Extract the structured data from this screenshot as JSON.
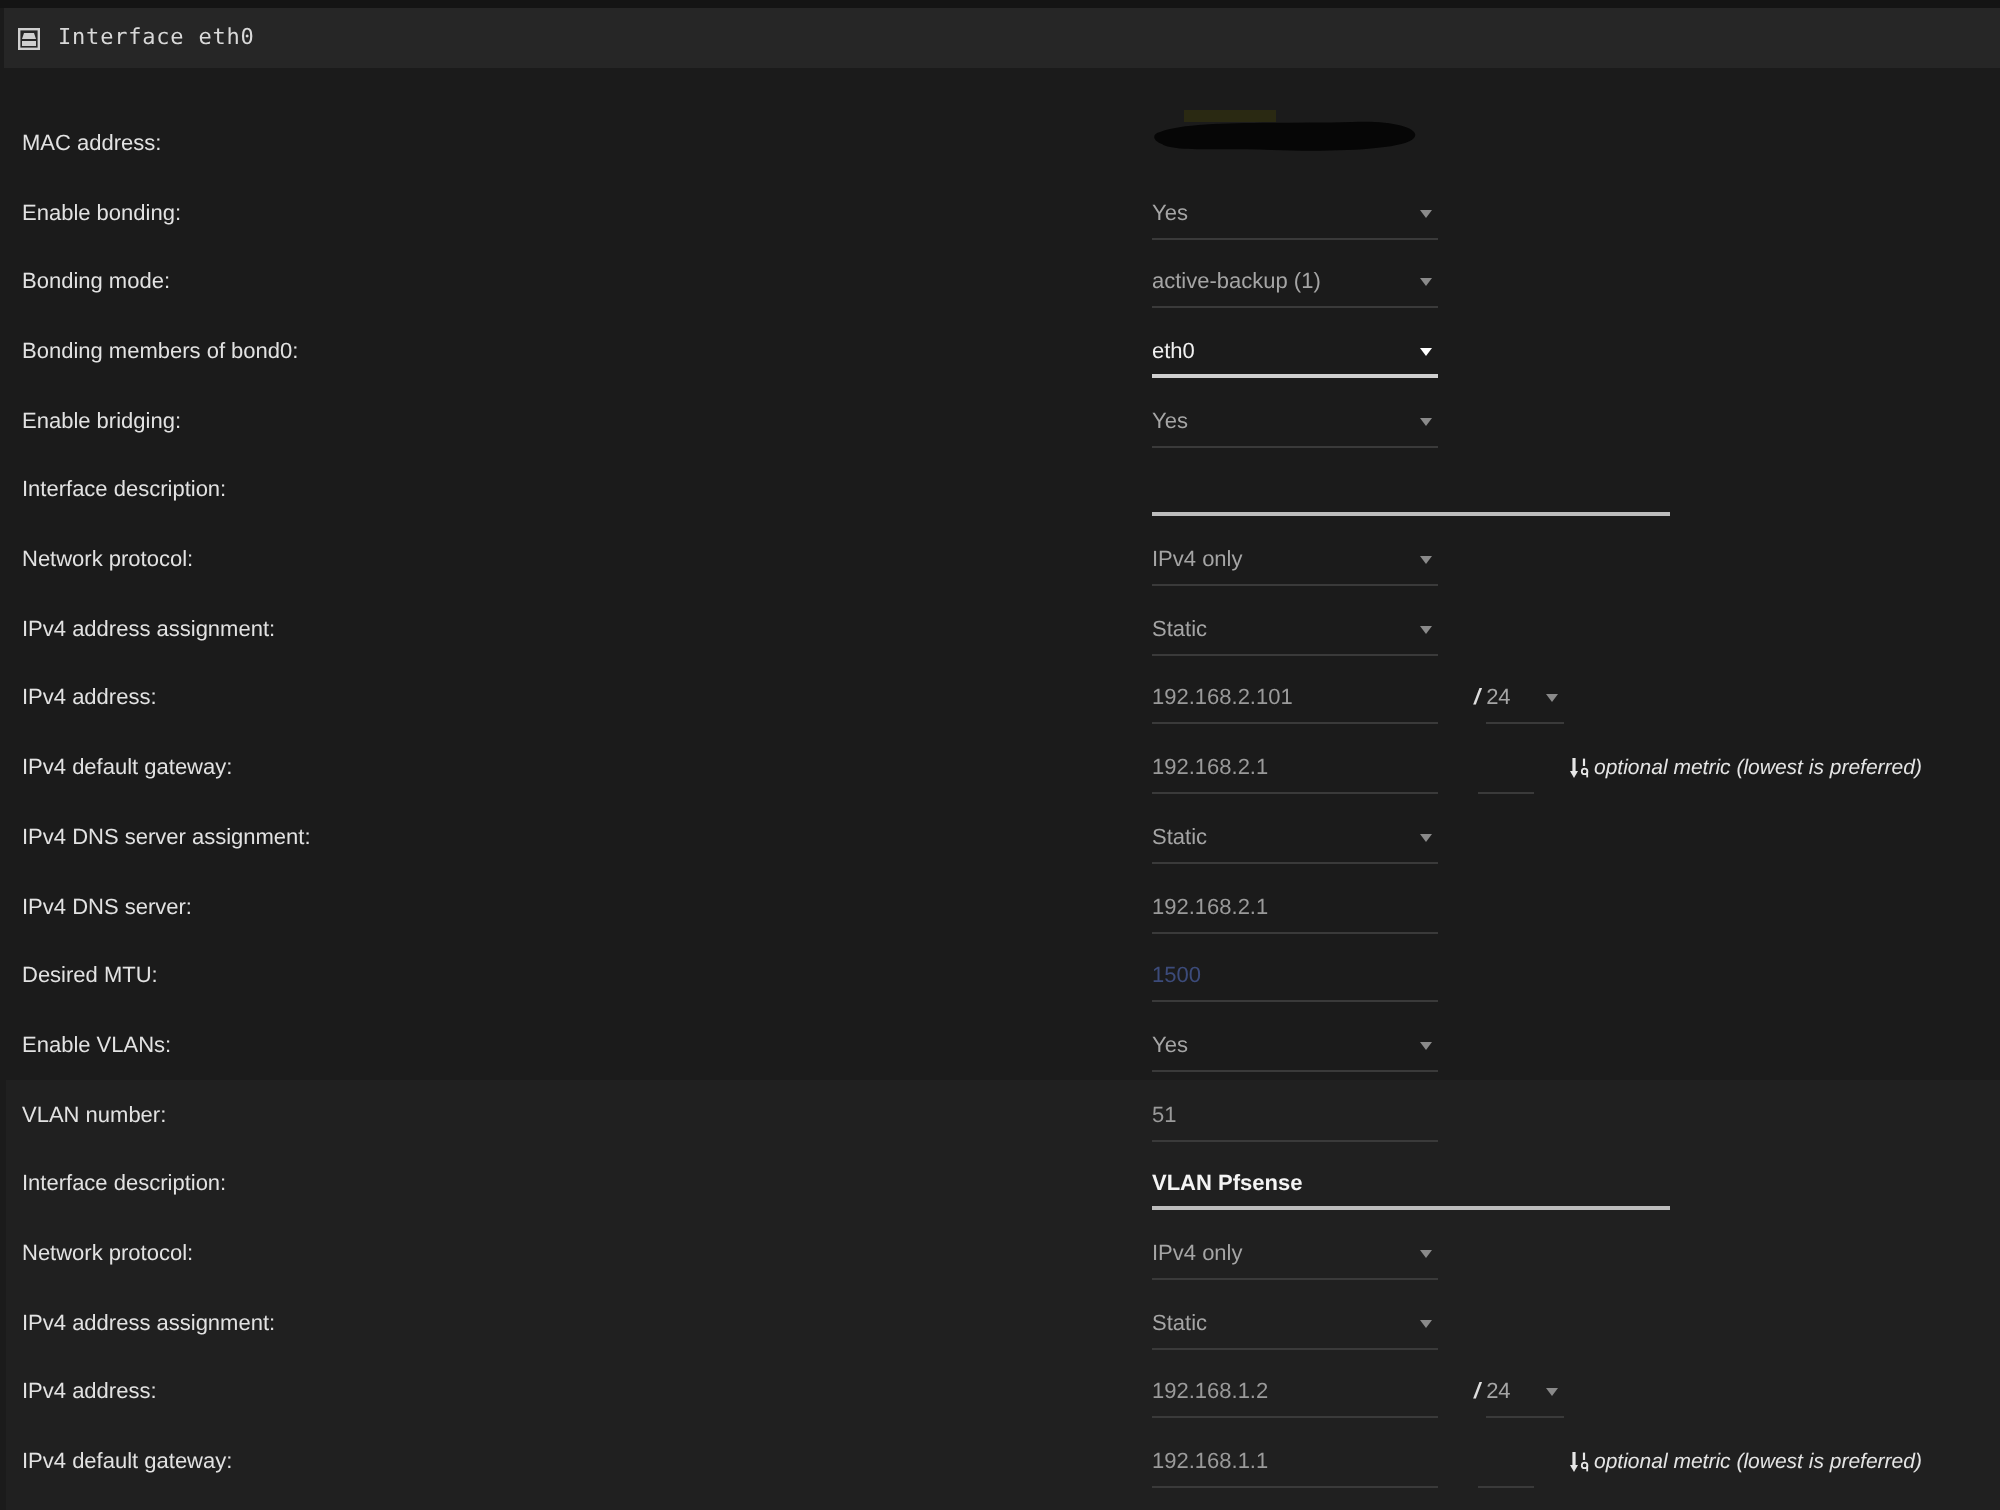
{
  "panel": {
    "title": "Interface eth0"
  },
  "fields": [
    {
      "kind": "redacted",
      "label": "MAC address:"
    },
    {
      "kind": "select",
      "label": "Enable bonding:",
      "value": "Yes",
      "focused": false
    },
    {
      "kind": "select",
      "label": "Bonding mode:",
      "value": "active-backup (1)",
      "focused": false
    },
    {
      "kind": "select",
      "label": "Bonding members of bond0:",
      "value": "eth0",
      "focused": true
    },
    {
      "kind": "select",
      "label": "Enable bridging:",
      "value": "Yes",
      "focused": false
    },
    {
      "kind": "longtext",
      "label": "Interface description:"
    },
    {
      "kind": "select",
      "label": "Network protocol:",
      "value": "IPv4 only",
      "focused": false
    },
    {
      "kind": "select",
      "label": "IPv4 address assignment:",
      "value": "Static",
      "focused": false
    },
    {
      "kind": "address",
      "label": "IPv4 address:",
      "value": "192.168.2.101",
      "separator": "/",
      "prefix": "24"
    },
    {
      "kind": "gateway",
      "label": "IPv4 default gateway:",
      "value": "192.168.2.1",
      "hint": "optional metric (lowest is preferred)"
    },
    {
      "kind": "select",
      "label": "IPv4 DNS server assignment:",
      "value": "Static",
      "focused": false
    },
    {
      "kind": "text",
      "label": "IPv4 DNS server:",
      "value": "192.168.2.1"
    },
    {
      "kind": "text",
      "label": "Desired MTU:",
      "placeholder": "1500"
    },
    {
      "kind": "select",
      "label": "Enable VLANs:",
      "value": "Yes",
      "focused": false
    }
  ],
  "vlan_fields": [
    {
      "kind": "text",
      "label": "VLAN number:",
      "value": "51"
    },
    {
      "kind": "longtext",
      "label": "Interface description:",
      "value": "VLAN Pfsense"
    },
    {
      "kind": "select",
      "label": "Network protocol:",
      "value": "IPv4 only",
      "focused": false
    },
    {
      "kind": "select",
      "label": "IPv4 address assignment:",
      "value": "Static",
      "focused": false
    },
    {
      "kind": "address",
      "label": "IPv4 address:",
      "value": "192.168.1.2",
      "separator": "/",
      "prefix": "24"
    },
    {
      "kind": "gateway",
      "label": "IPv4 default gateway:",
      "value": "192.168.1.1",
      "hint": "optional metric (lowest is preferred)"
    }
  ]
}
